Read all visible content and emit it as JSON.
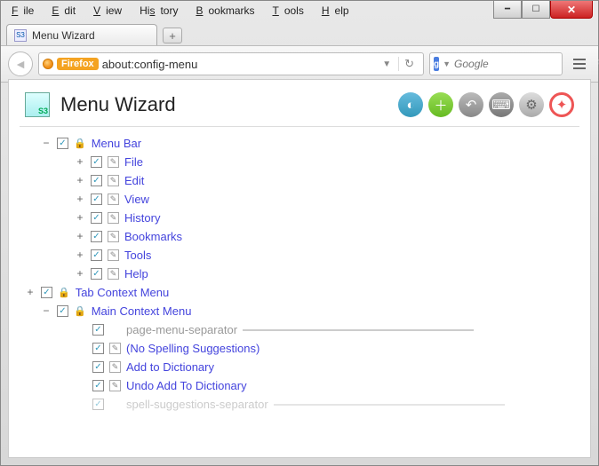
{
  "menubar": {
    "file": "ile",
    "edit": "dit",
    "view": "iew",
    "history": "tory",
    "bookmarks": "ookmarks",
    "tools": "ools",
    "help": "elp"
  },
  "tab": {
    "title": "Menu Wizard"
  },
  "urlbar": {
    "identity": "Firefox",
    "url": "about:config-menu"
  },
  "search": {
    "placeholder": "Google"
  },
  "page": {
    "title": "Menu Wizard"
  },
  "tree": [
    {
      "label": "Menu Bar",
      "expanded": true,
      "children": [
        {
          "label": "File"
        },
        {
          "label": "Edit"
        },
        {
          "label": "View"
        },
        {
          "label": "History"
        },
        {
          "label": "Bookmarks"
        },
        {
          "label": "Tools"
        },
        {
          "label": "Help"
        }
      ]
    },
    {
      "label": "Tab Context Menu",
      "expanded": false
    },
    {
      "label": "Main Context Menu",
      "expanded": true,
      "children": [
        {
          "label": "page-menu-separator",
          "separator": true
        },
        {
          "label": "(No Spelling Suggestions)"
        },
        {
          "label": "Add to Dictionary"
        },
        {
          "label": "Undo Add To Dictionary"
        },
        {
          "label": "spell-suggestions-separator",
          "separator": true
        }
      ]
    }
  ]
}
